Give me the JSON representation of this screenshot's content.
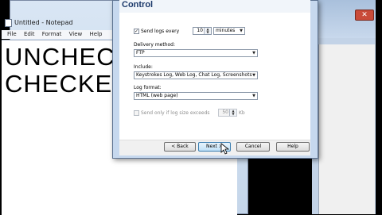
{
  "notepad": {
    "title": "Untitled - Notepad",
    "menu": [
      "File",
      "Edit",
      "Format",
      "View",
      "Help"
    ],
    "lines": [
      "UNCHEC",
      "CHECKE"
    ]
  },
  "dialog": {
    "heading": "Control",
    "send_logs": {
      "label": "Send logs every",
      "checked": true,
      "value": "10",
      "unit": "minutes"
    },
    "delivery": {
      "label": "Delivery method:",
      "value": "FTP"
    },
    "include": {
      "label": "Include:",
      "value": "Keystrokes Log, Web Log, Chat Log, Screenshots"
    },
    "log_format": {
      "label": "Log format:",
      "value": "HTML (web page)"
    },
    "size_limit": {
      "label": "Send only if log size exceeds",
      "value": "50",
      "unit": "Kb",
      "checked": false
    },
    "buttons": {
      "back": "< Back",
      "next": "Next >",
      "cancel": "Cancel",
      "help": "Help"
    }
  },
  "colors": {
    "dialog_frame": "#c6d8ee",
    "heading": "#1d3a6b",
    "default_button": "#bfe0f7"
  }
}
